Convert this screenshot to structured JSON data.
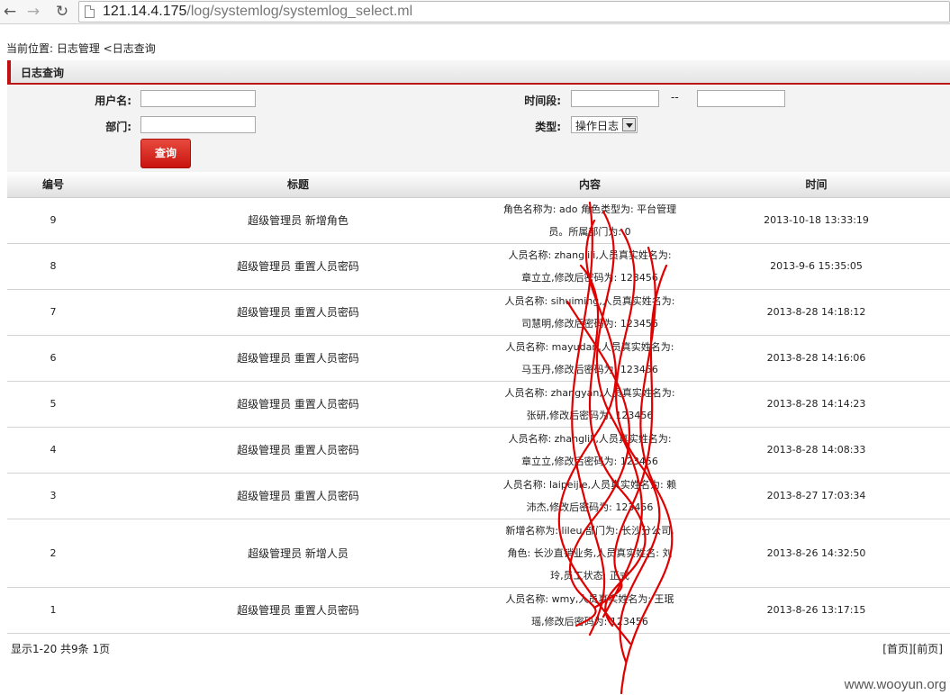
{
  "browser": {
    "url_host": "121.14.4.175",
    "url_path": "/log/systemlog/systemlog_select.ml",
    "back_icon": "arrow-left",
    "forward_icon": "arrow-right",
    "reload_icon": "reload"
  },
  "breadcrumb": "当前位置: 日志管理 <日志查询",
  "panel": {
    "title": "日志查询"
  },
  "form": {
    "username_label": "用户名:",
    "username_value": "",
    "department_label": "部门:",
    "department_value": "",
    "time_label": "时间段:",
    "time_from_value": "",
    "time_separator": "--",
    "time_to_value": "",
    "type_label": "类型:",
    "type_selected": "操作日志",
    "query_button": "查询",
    "accent_color": "#c8140e"
  },
  "table": {
    "headers": [
      "编号",
      "标题",
      "内容",
      "时间"
    ],
    "rows": [
      {
        "id": "9",
        "title": "超级管理员 新增角色",
        "content": "角色名称为: ado 角色类型为: 平台管理员。所属部门为: 0",
        "time": "2013-10-18 13:33:19"
      },
      {
        "id": "8",
        "title": "超级管理员 重置人员密码",
        "content": "人员名称: zhanglili,人员真实姓名为: 章立立,修改后密码为: 123456",
        "time": "2013-9-6 15:35:05"
      },
      {
        "id": "7",
        "title": "超级管理员 重置人员密码",
        "content": "人员名称: sihuiming,人员真实姓名为: 司慧明,修改后密码为: 123456",
        "time": "2013-8-28 14:18:12"
      },
      {
        "id": "6",
        "title": "超级管理员 重置人员密码",
        "content": "人员名称: mayudan,人员真实姓名为: 马玉丹,修改后密码为: 123456",
        "time": "2013-8-28 14:16:06"
      },
      {
        "id": "5",
        "title": "超级管理员 重置人员密码",
        "content": "人员名称: zhangyan,人员真实姓名为: 张研,修改后密码为: 123456",
        "time": "2013-8-28 14:14:23"
      },
      {
        "id": "4",
        "title": "超级管理员 重置人员密码",
        "content": "人员名称: zhanglili,人员真实姓名为: 章立立,修改后密码为: 123456",
        "time": "2013-8-28 14:08:33"
      },
      {
        "id": "3",
        "title": "超级管理员 重置人员密码",
        "content": "人员名称: laipeijie,人员真实姓名为: 赖沛杰,修改后密码为: 123456",
        "time": "2013-8-27 17:03:34"
      },
      {
        "id": "2",
        "title": "超级管理员 新增人员",
        "content": "新增名称为: lileu,部门为: 长沙分公司,角色: 长沙直销业务,人员真实姓名: 刘玲,员工状态: 正式",
        "time": "2013-8-26 14:32:50"
      },
      {
        "id": "1",
        "title": "超级管理员 重置人员密码",
        "content": "人员名称: wmy,人员真实姓名为: 王珉瑶,修改后密码为: 123456",
        "time": "2013-8-26 13:17:15"
      }
    ]
  },
  "footer": {
    "summary": "显示1-20 共9条 1页",
    "first_page": "[首页]",
    "prev_page": "[前页]"
  },
  "watermark": "www.wooyun.org",
  "annotation_color": "#e00000"
}
